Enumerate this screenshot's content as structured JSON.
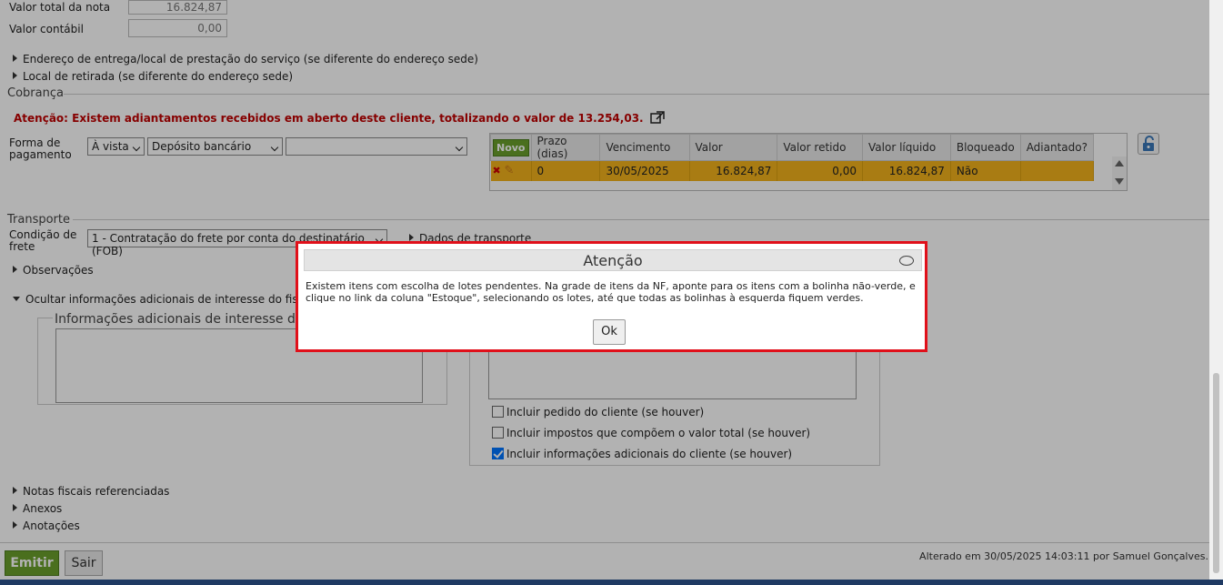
{
  "totals": {
    "valor_total_label": "Valor total da nota",
    "valor_total_value": "16.824,87",
    "valor_contabil_label": "Valor contábil",
    "valor_contabil_value": "0,00"
  },
  "sections": {
    "endereco_entrega": "Endereço de entrega/local de prestação do serviço (se diferente do endereço sede)",
    "local_retirada": "Local de retirada (se diferente do endereço sede)",
    "cobranca": "Cobrança",
    "transporte": "Transporte",
    "observacoes": "Observações",
    "ocultar_info": "Ocultar informações adicionais de interesse do fisco e do",
    "notas_ref": "Notas fiscais referenciadas",
    "anexos": "Anexos",
    "anotacoes": "Anotações"
  },
  "cobranca": {
    "warning": "Atenção: Existem adiantamentos recebidos em aberto deste cliente, totalizando o valor de 13.254,03.",
    "forma_label_1": "Forma de",
    "forma_label_2": "pagamento",
    "sel_tipo": "À vista",
    "sel_meio": "Depósito bancário",
    "sel_extra": "",
    "novo_label": "Novo",
    "columns": [
      "Prazo (dias)",
      "Vencimento",
      "Valor",
      "Valor retido",
      "Valor líquido",
      "Bloqueado",
      "Adiantado?"
    ],
    "row": {
      "prazo": "0",
      "vencimento": "30/05/2025",
      "valor": "16.824,87",
      "valor_retido": "0,00",
      "valor_liquido": "16.824,87",
      "bloqueado": "Não",
      "adiantado": ""
    }
  },
  "transporte": {
    "condicao_label_1": "Condição de",
    "condicao_label_2": "frete",
    "condicao_value": "1 - Contratação do frete por conta do destinatário (FOB)",
    "dados_transporte": "Dados de transporte"
  },
  "info_fisco": {
    "legend": "Informações adicionais de interesse do fis"
  },
  "checkboxes": [
    {
      "label": "Incluir pedido do cliente (se houver)",
      "checked": false
    },
    {
      "label": "Incluir impostos que compõem o valor total (se houver)",
      "checked": false
    },
    {
      "label": "Incluir informações adicionais do cliente (se houver)",
      "checked": true
    }
  ],
  "footer": {
    "emitir": "Emitir",
    "sair": "Sair",
    "altered": "Alterado em 30/05/2025 14:03:11 por Samuel Gonçalves."
  },
  "modal": {
    "title": "Atenção",
    "message": "Existem itens com escolha de lotes pendentes. Na grade de itens da NF, aponte para os itens com a bolinha não-verde, e clique no link da coluna \"Estoque\", selecionando os lotes, até que todas as bolinhas à esquerda fiquem verdes.",
    "ok": "Ok"
  },
  "colors": {
    "accent_green": "#6aa02b",
    "row_highlight": "#f2b21c",
    "warning_red": "#c00000",
    "modal_border": "#e0101a"
  }
}
